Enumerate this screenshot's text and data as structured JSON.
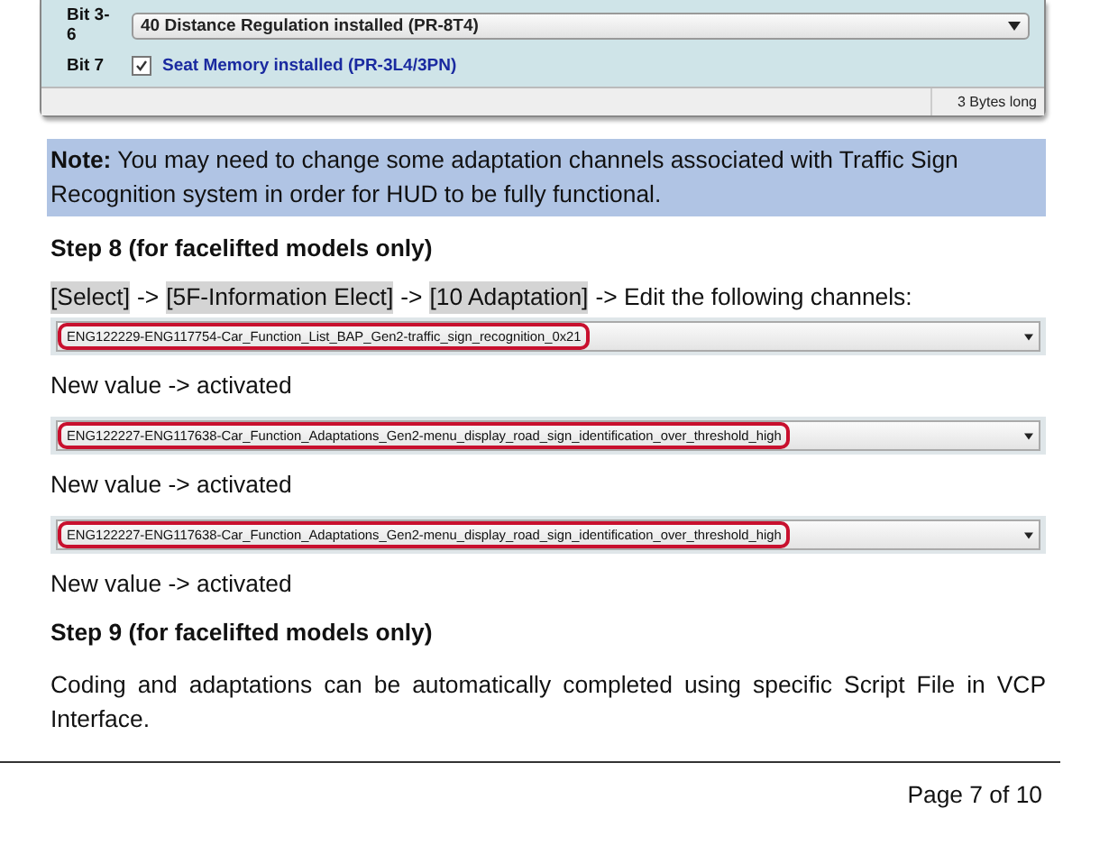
{
  "coding_panel": {
    "rows": [
      {
        "kind": "dropdown",
        "bit": "Bit 3-6",
        "label": "40 Distance Regulation installed (PR-8T4)"
      },
      {
        "kind": "checkbox",
        "bit": "Bit 7",
        "checked": true,
        "label": "Seat Memory installed (PR-3L4/3PN)"
      }
    ],
    "status": "3 Bytes long"
  },
  "note": "**Note:** You may need to change some adaptation channels associated with Traffic Sign Recognition system in order for HUD to be fully functional.",
  "content": [
    {
      "kind": "heading",
      "text": "Step 8 (for facelifted models only)"
    },
    {
      "kind": "path",
      "segments": [
        {
          "text": "[Select]",
          "highlighted": true
        },
        {
          "text": "->",
          "highlighted": false
        },
        {
          "text": "[5F-Information Elect]",
          "highlighted": true
        },
        {
          "text": "->",
          "highlighted": false
        },
        {
          "text": "[10 Adaptation]",
          "highlighted": true
        },
        {
          "text": "-> Edit the following channels:",
          "highlighted": false
        }
      ]
    },
    {
      "kind": "select",
      "value": "ENG122229-ENG117754-Car_Function_List_BAP_Gen2-traffic_sign_recognition_0x21"
    },
    {
      "kind": "text",
      "text": "New value -> activated"
    },
    {
      "kind": "select",
      "value": "ENG122227-ENG117638-Car_Function_Adaptations_Gen2-menu_display_road_sign_identification_over_threshold_high"
    },
    {
      "kind": "text",
      "text": "New value -> activated"
    },
    {
      "kind": "select",
      "value": "ENG122227-ENG117638-Car_Function_Adaptations_Gen2-menu_display_road_sign_identification_over_threshold_high"
    },
    {
      "kind": "text",
      "text": "New value -> activated"
    },
    {
      "kind": "heading",
      "text": "Step 9 (for facelifted models only)"
    },
    {
      "kind": "paragraph",
      "text": "Coding and adaptations can be automatically completed using specific Script File in VCP Interface."
    }
  ],
  "footer": {
    "page": "Page 7 of 10"
  }
}
